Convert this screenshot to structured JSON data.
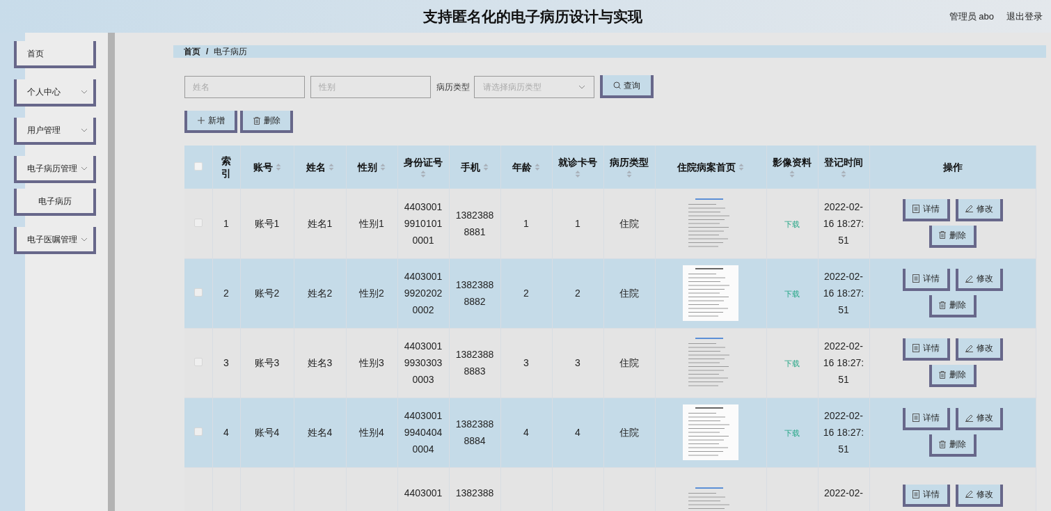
{
  "header": {
    "title": "支持匿名化的电子病历设计与实现",
    "user": "管理员 abo",
    "logout": "退出登录"
  },
  "sidebar": {
    "items": [
      {
        "label": "首页",
        "kind": "link"
      },
      {
        "label": "个人中心",
        "kind": "group"
      },
      {
        "label": "用户管理",
        "kind": "group"
      },
      {
        "label": "电子病历管理",
        "kind": "group",
        "children": [
          {
            "label": "电子病历",
            "kind": "sub"
          }
        ]
      },
      {
        "label": "电子医嘱管理",
        "kind": "group"
      }
    ]
  },
  "breadcrumb": {
    "items": [
      "首页",
      "电子病历"
    ],
    "separator": "/"
  },
  "search": {
    "fields": [
      {
        "placeholder": "姓名"
      },
      {
        "placeholder": "性别"
      }
    ],
    "type_label": "病历类型",
    "type_select": {
      "placeholder": "请选择病历类型"
    },
    "button": "查询"
  },
  "actions": [
    {
      "label": "新增",
      "kind": "add"
    },
    {
      "label": "删除",
      "kind": "delete"
    }
  ],
  "table": {
    "select_all_checked": false,
    "columns": [
      {
        "label": "索引"
      },
      {
        "label": "账号",
        "sortable": true
      },
      {
        "label": "姓名",
        "sortable": true
      },
      {
        "label": "性别",
        "sortable": true
      },
      {
        "label": "身份证号",
        "sortable": true
      },
      {
        "label": "手机",
        "sortable": true
      },
      {
        "label": "年龄",
        "sortable": true
      },
      {
        "label": "就诊卡号",
        "sortable": true
      },
      {
        "label": "病历类型",
        "sortable": true
      },
      {
        "label": "住院病案首页",
        "sortable": true
      },
      {
        "label": "影像资料",
        "sortable": true
      },
      {
        "label": "登记时间",
        "sortable": true
      },
      {
        "label": "操作"
      }
    ],
    "rows": [
      {
        "kind": "full",
        "checked": false,
        "cells": [
          "1",
          "账号1",
          "姓名1",
          "性别1",
          "440300199101010001",
          "13823888881",
          "1",
          "1",
          "住院"
        ],
        "first_page": {
          "kind": "picture"
        },
        "image_link": "下载",
        "time": "2022-02-16 18:27:51",
        "actions": [
          "详情",
          "修改",
          "删除"
        ]
      },
      {
        "kind": "full",
        "checked": false,
        "cells": [
          "2",
          "账号2",
          "姓名2",
          "性别2",
          "440300199202020002",
          "13823888882",
          "2",
          "2",
          "住院"
        ],
        "first_page": {
          "kind": "picture"
        },
        "image_link": "下载",
        "time": "2022-02-16 18:27:51",
        "actions": [
          "详情",
          "修改",
          "删除"
        ]
      },
      {
        "kind": "full",
        "checked": false,
        "cells": [
          "3",
          "账号3",
          "姓名3",
          "性别3",
          "440300199303030003",
          "13823888883",
          "3",
          "3",
          "住院"
        ],
        "first_page": {
          "kind": "picture"
        },
        "image_link": "下载",
        "time": "2022-02-16 18:27:51",
        "actions": [
          "详情",
          "修改",
          "删除"
        ]
      },
      {
        "kind": "full",
        "checked": false,
        "cells": [
          "4",
          "账号4",
          "姓名4",
          "性别4",
          "440300199404040004",
          "13823888884",
          "4",
          "4",
          "住院"
        ],
        "first_page": {
          "kind": "picture"
        },
        "image_link": "下载",
        "time": "2022-02-16 18:27:51",
        "actions": [
          "详情",
          "修改",
          "删除"
        ]
      },
      {
        "kind": "partial",
        "cells": [
          "",
          "",
          "",
          "",
          "4403001",
          "1382388",
          "",
          "",
          ""
        ],
        "first_page": {
          "kind": "picture"
        },
        "time": "2022-02-",
        "actions": [
          "详情",
          "修改"
        ]
      }
    ]
  }
}
